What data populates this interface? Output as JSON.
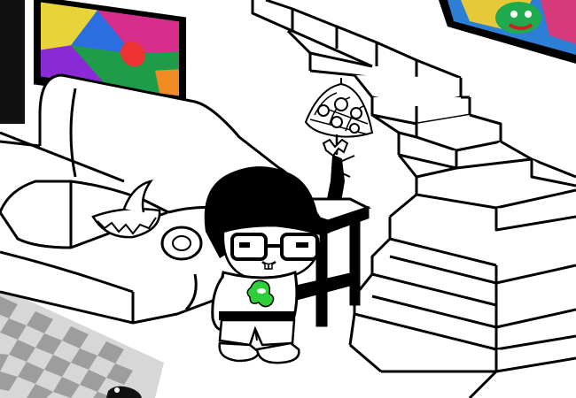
{
  "scene": {
    "colors": {
      "background": "#ffffff",
      "outline": "#000000",
      "shirt_symbol": "#2fcf3a",
      "shirt": "#ffffff",
      "skin": "#ffffff",
      "hair": "#000000",
      "rug_light": "#e2e2e2",
      "rug_dark": "#9c9c9c"
    },
    "objects": [
      "left-painting",
      "right-painting",
      "couch",
      "shark-fin-hat",
      "staircase",
      "lamp",
      "figurine",
      "side-table",
      "checkered-rug",
      "character-john",
      "green-slime-symbol",
      "small-toy-on-floor"
    ]
  }
}
